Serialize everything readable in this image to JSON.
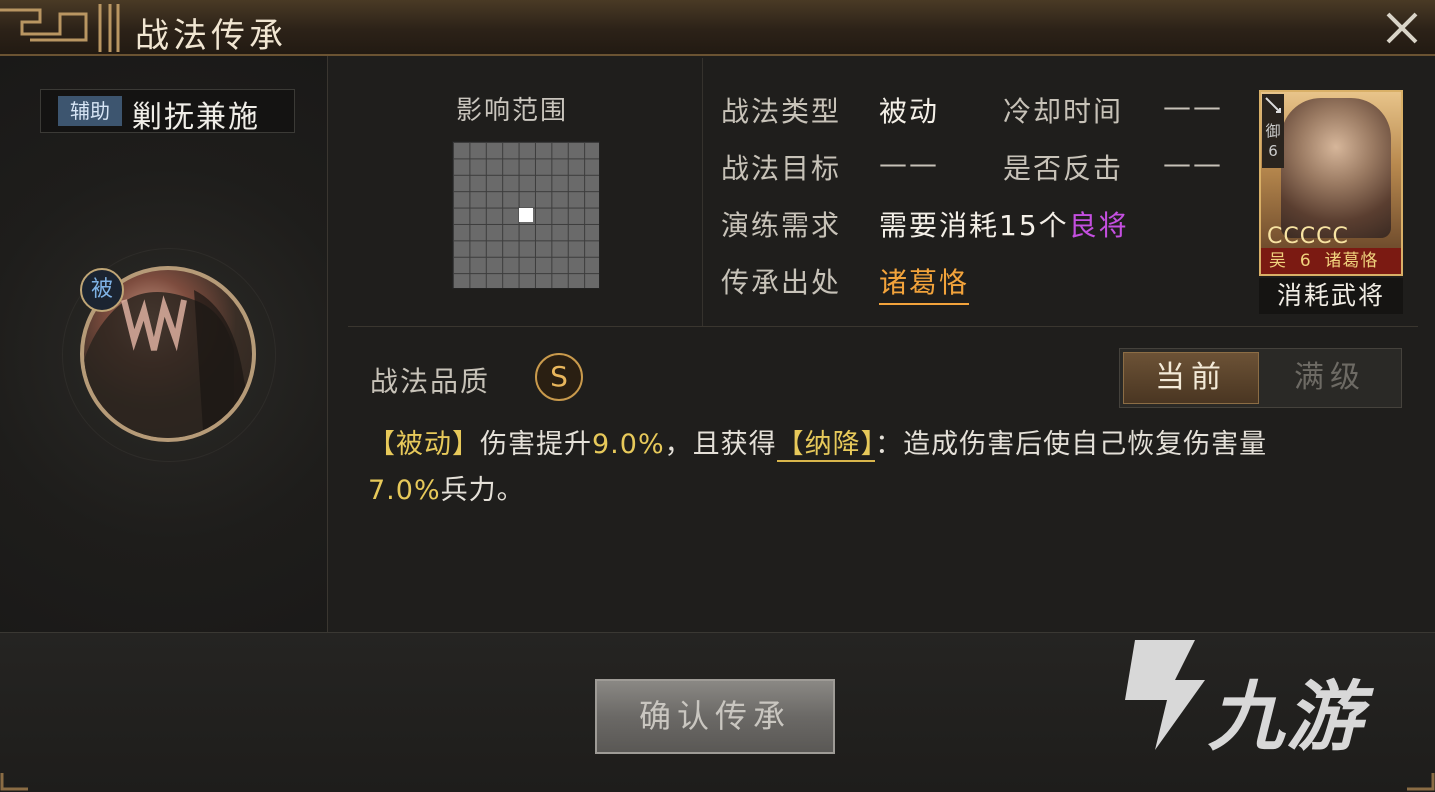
{
  "window": {
    "title": "战法传承"
  },
  "skill": {
    "category_badge": "辅助",
    "name": "剿抚兼施",
    "passive_mark": "被"
  },
  "range": {
    "label": "影响范围",
    "grid_size": 9,
    "highlight_cell": [
      5,
      5
    ]
  },
  "info": {
    "type_label": "战法类型",
    "type_value": "被动",
    "cooldown_label": "冷却时间",
    "cooldown_value": "——",
    "target_label": "战法目标",
    "target_value": "——",
    "counter_label": "是否反击",
    "counter_value": "——",
    "requirement_label": "演练需求",
    "requirement_prefix": "需要消耗",
    "requirement_count": "15",
    "requirement_unit": "个",
    "requirement_quality": "良将",
    "source_label": "传承出处",
    "source_value": "诸葛恪"
  },
  "card": {
    "troop_type": "御",
    "troop_level": "6",
    "stars": "CCCCC",
    "faction": "吴",
    "cost": "6",
    "name": "诸葛恪",
    "label": "消耗武将"
  },
  "quality": {
    "label": "战法品质",
    "grade": "S"
  },
  "tabs": {
    "current": "当前",
    "max": "满级"
  },
  "description": {
    "tag1": "【被动】",
    "text1": "伤害提升",
    "value1": "9.0%",
    "text2": "，且获得",
    "tag2": "【纳降】",
    "text3": "：造成伤害后使自己恢复伤害量",
    "value2": "7.0%",
    "text4": "兵力。"
  },
  "footer": {
    "confirm_label": "确认传承"
  },
  "watermark": {
    "text": "九游"
  },
  "colors": {
    "accent_orange": "#f2a33b",
    "accent_purple": "#c44fe0",
    "accent_gold": "#e7c95a",
    "badge_blue": "#3d556f"
  }
}
